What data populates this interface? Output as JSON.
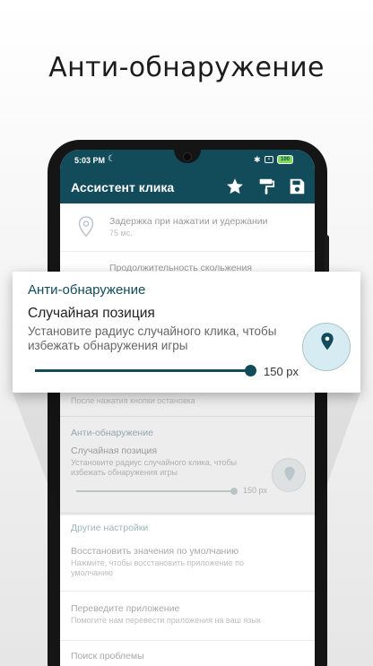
{
  "headline": "Анти-обнаружение",
  "status_bar": {
    "time": "5:03 PM",
    "battery": "100"
  },
  "app_bar": {
    "title": "Ассистент клика",
    "icons": [
      "star-icon",
      "paint-roller-icon",
      "save-icon"
    ]
  },
  "settings": {
    "rows": [
      {
        "title": "Задержка при нажатии и удержании",
        "subtitle": "75 мс.",
        "icon": "location-pin-icon"
      },
      {
        "title": "Продолжительность скольжения"
      }
    ],
    "stop_row": {
      "subtitle": "После нажатия кнопки остановка"
    },
    "anti_detect": {
      "section": "Анти-обнаружение",
      "title": "Случайная позиция",
      "subtitle": "Установите радиус случайного клика, чтобы избежать обнаружения игры",
      "value": "150 px"
    },
    "other_section": "Другие настройки",
    "reset": {
      "title": "Восстановить значения по умолчанию",
      "subtitle": "Нажмите, чтобы восстановить приложение по умолчанию"
    },
    "translate": {
      "title": "Переведите приложение",
      "subtitle": "Помогите нам перевести приложения на ваш язык"
    },
    "troubleshoot": {
      "title": "Поиск проблемы"
    }
  },
  "card": {
    "category": "Анти-обнаружение",
    "title": "Случайная позиция",
    "description": "Установите радиус случайного клика, чтобы избежать обнаружения игры",
    "slider_value": "150 px",
    "slider_level": 1.0
  },
  "colors": {
    "primary": "#124b5a",
    "preview_fill": "#d7ecf2"
  }
}
